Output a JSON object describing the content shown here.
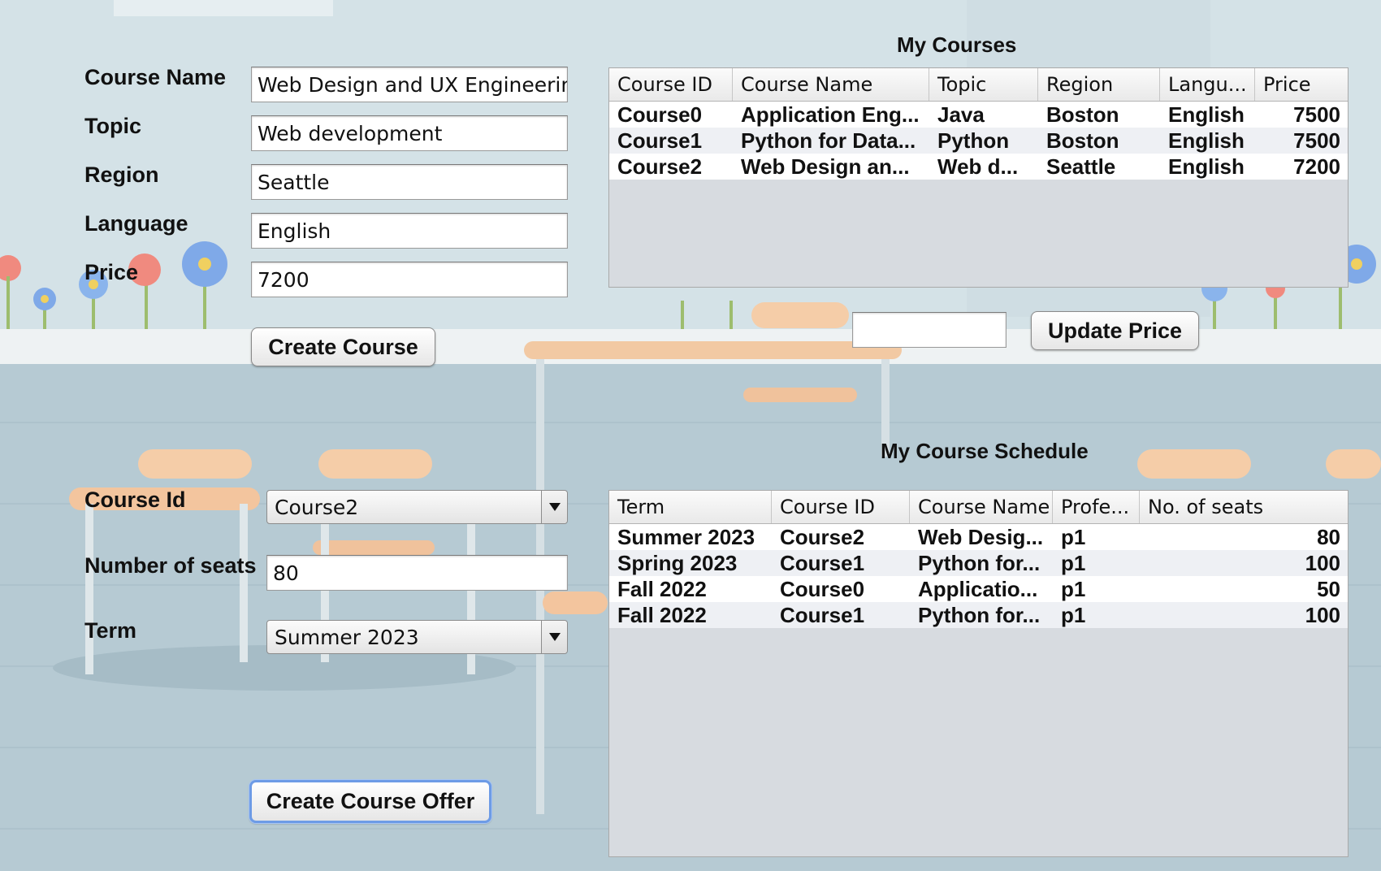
{
  "course_form": {
    "course_name_label": "Course Name",
    "topic_label": "Topic",
    "region_label": "Region",
    "language_label": "Language",
    "price_label": "Price",
    "course_name_value": "Web Design and UX Engineering",
    "topic_value": "Web development",
    "region_value": "Seattle",
    "language_value": "English",
    "price_value": "7200",
    "create_course_button": "Create Course"
  },
  "my_courses": {
    "title": "My Courses",
    "columns": [
      "Course ID",
      "Course Name",
      "Topic",
      "Region",
      "Langu...",
      "Price"
    ],
    "rows": [
      [
        "Course0",
        "Application Eng...",
        "Java",
        "Boston",
        "English",
        "7500"
      ],
      [
        "Course1",
        "Python for Data...",
        "Python",
        "Boston",
        "English",
        "7500"
      ],
      [
        "Course2",
        "Web Design an...",
        "Web d...",
        "Seattle",
        "English",
        "7200"
      ]
    ],
    "update_price_value": "",
    "update_price_button": "Update Price"
  },
  "offer_form": {
    "course_id_label": "Course Id",
    "course_id_value": "Course2",
    "seats_label": "Number of seats",
    "seats_value": "80",
    "term_label": "Term",
    "term_value": "Summer 2023",
    "create_offer_button": "Create Course Offer"
  },
  "schedule": {
    "title": "My Course Schedule",
    "columns": [
      "Term",
      "Course ID",
      "Course Name",
      "Profe...",
      "No. of seats"
    ],
    "rows": [
      [
        "Summer 2023",
        "Course2",
        "Web Desig...",
        "p1",
        "80"
      ],
      [
        "Spring 2023",
        "Course1",
        "Python for...",
        "p1",
        "100"
      ],
      [
        "Fall 2022",
        "Course0",
        "Applicatio...",
        "p1",
        "50"
      ],
      [
        "Fall 2022",
        "Course1",
        "Python for...",
        "p1",
        "100"
      ]
    ]
  }
}
